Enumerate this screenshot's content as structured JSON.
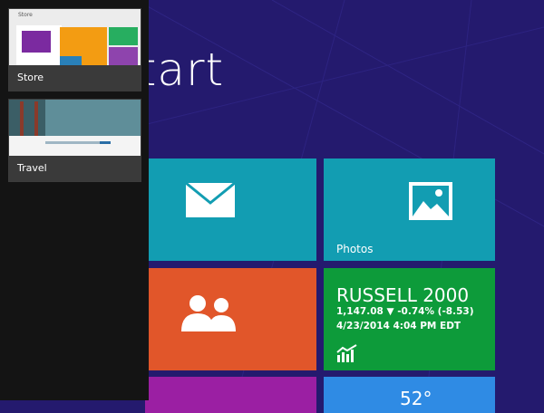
{
  "start_screen": {
    "title": "Start",
    "tiles": {
      "mail": {
        "label": ""
      },
      "photos": {
        "label": "Photos"
      },
      "people": {
        "label": ""
      },
      "finance": {
        "name": "RUSSELL 2000",
        "quote": "1,147.08 ▼ -0.74% (-8.53)",
        "timestamp": "4/23/2014 4:04 PM EDT"
      },
      "weather": {
        "temperature": "52°"
      }
    }
  },
  "switcher": {
    "apps": [
      {
        "label": "Store",
        "preview_heading": "Store"
      },
      {
        "label": "Travel"
      }
    ]
  },
  "colors": {
    "background": "#241a6e",
    "mail_tile": "#129db2",
    "photos_tile": "#129db2",
    "people_tile": "#e1562a",
    "finance_tile": "#0d9b3a",
    "purple_tile": "#9b1fa3",
    "weather_tile": "#2f8be4",
    "switcher_panel": "#141414"
  }
}
